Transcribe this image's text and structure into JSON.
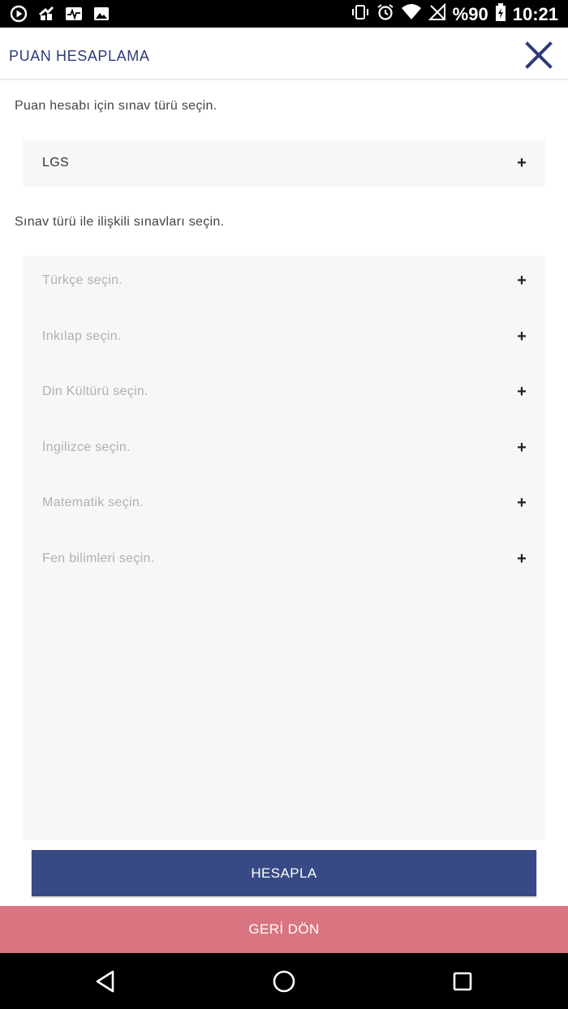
{
  "status_bar": {
    "left_icons": [
      "play-store-icon",
      "notification-icon",
      "heartbeat-icon",
      "gallery-icon"
    ],
    "battery": "%90",
    "time": "10:21"
  },
  "header": {
    "title": "PUAN HESAPLAMA",
    "close_icon": "close-icon"
  },
  "exam_type": {
    "prompt": "Puan hesabı için sınav türü seçin.",
    "selected": "LGS"
  },
  "exams": {
    "prompt": "Sınav türü ile ilişkili sınavları seçin.",
    "items": [
      "Türkçe seçin.",
      "Inkılap seçin.",
      "Din Kültürü seçin.",
      "İngilizce seçin.",
      "Matematik seçin.",
      "Fen bilimleri seçin."
    ]
  },
  "buttons": {
    "calculate": "HESAPLA",
    "back": "GERİ DÖN"
  },
  "colors": {
    "primary": "#374a86",
    "secondary": "#d97580",
    "title": "#2e3b78"
  }
}
